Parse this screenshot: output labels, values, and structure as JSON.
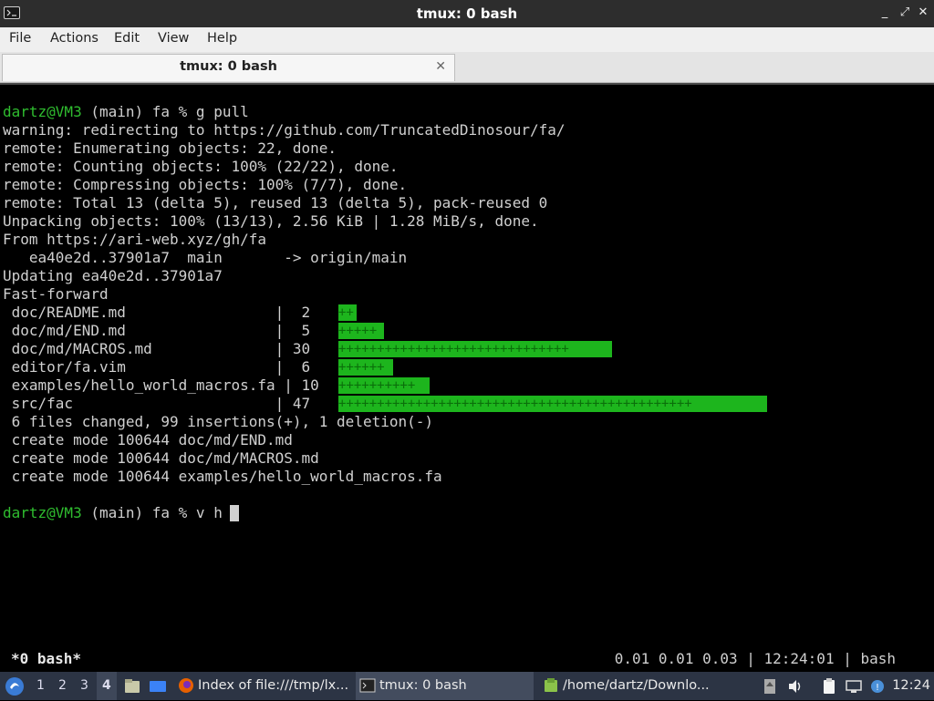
{
  "window": {
    "title": "tmux: 0 bash",
    "buttons": {
      "minimize": "_",
      "maximize": "⤢",
      "close": "✕"
    }
  },
  "menu": [
    "File",
    "Actions",
    "Edit",
    "View",
    "Help"
  ],
  "tab": {
    "label": "tmux: 0 bash",
    "close": "✕"
  },
  "terminal": {
    "prompt": "dartz@VM3",
    "prompt_rest_1": " (main) fa % g pull",
    "lines": [
      "warning: redirecting to https://github.com/TruncatedDinosour/fa/",
      "remote: Enumerating objects: 22, done.",
      "remote: Counting objects: 100% (22/22), done.",
      "remote: Compressing objects: 100% (7/7), done.",
      "remote: Total 13 (delta 5), reused 13 (delta 5), pack-reused 0",
      "Unpacking objects: 100% (13/13), 2.56 KiB | 1.28 MiB/s, done.",
      "From https://ari-web.xyz/gh/fa",
      "   ea40e2d..37901a7  main       -> origin/main",
      "Updating ea40e2d..37901a7",
      "Fast-forward"
    ],
    "diffstat": [
      {
        "text": " doc/README.md                 |  2 ",
        "bar": "++",
        "count": 2
      },
      {
        "text": " doc/md/END.md                 |  5 ",
        "bar": "+++++",
        "count": 5
      },
      {
        "text": " doc/md/MACROS.md              | 30 ",
        "bar": "++++++++++++++++++++++++++++++",
        "count": 30
      },
      {
        "text": " editor/fa.vim                 |  6 ",
        "bar": "++++++",
        "count": 6
      },
      {
        "text": " examples/hello_world_macros.fa | 10 ",
        "bar": "++++++++++",
        "count": 10
      },
      {
        "text": " src/fac                       | 47 ",
        "bar": "++++++++++++++++++++++++++++++++++++++++++++++",
        "count": 47
      }
    ],
    "summary": [
      " 6 files changed, 99 insertions(+), 1 deletion(-)",
      " create mode 100644 doc/md/END.md",
      " create mode 100644 doc/md/MACROS.md",
      " create mode 100644 examples/hello_world_macros.fa"
    ],
    "prompt_rest_2": " (main) fa % v h"
  },
  "tmux_status": {
    "left": "*0 bash*",
    "right": "0.01 0.01 0.03 | 12:24:01 | bash"
  },
  "taskbar": {
    "workspaces": [
      "1",
      "2",
      "3",
      "4"
    ],
    "active_workspace": "4",
    "tasks": [
      {
        "label": "Index of file:///tmp/lx...",
        "icon": "firefox-icon"
      },
      {
        "label": "tmux: 0 bash",
        "icon": "terminal-icon"
      },
      {
        "label": "/home/dartz/Downlo...",
        "icon": "folder-icon"
      }
    ],
    "clock": "12:24",
    "colors": {
      "bar": "#2c3444",
      "accent": "#1db51d"
    }
  }
}
